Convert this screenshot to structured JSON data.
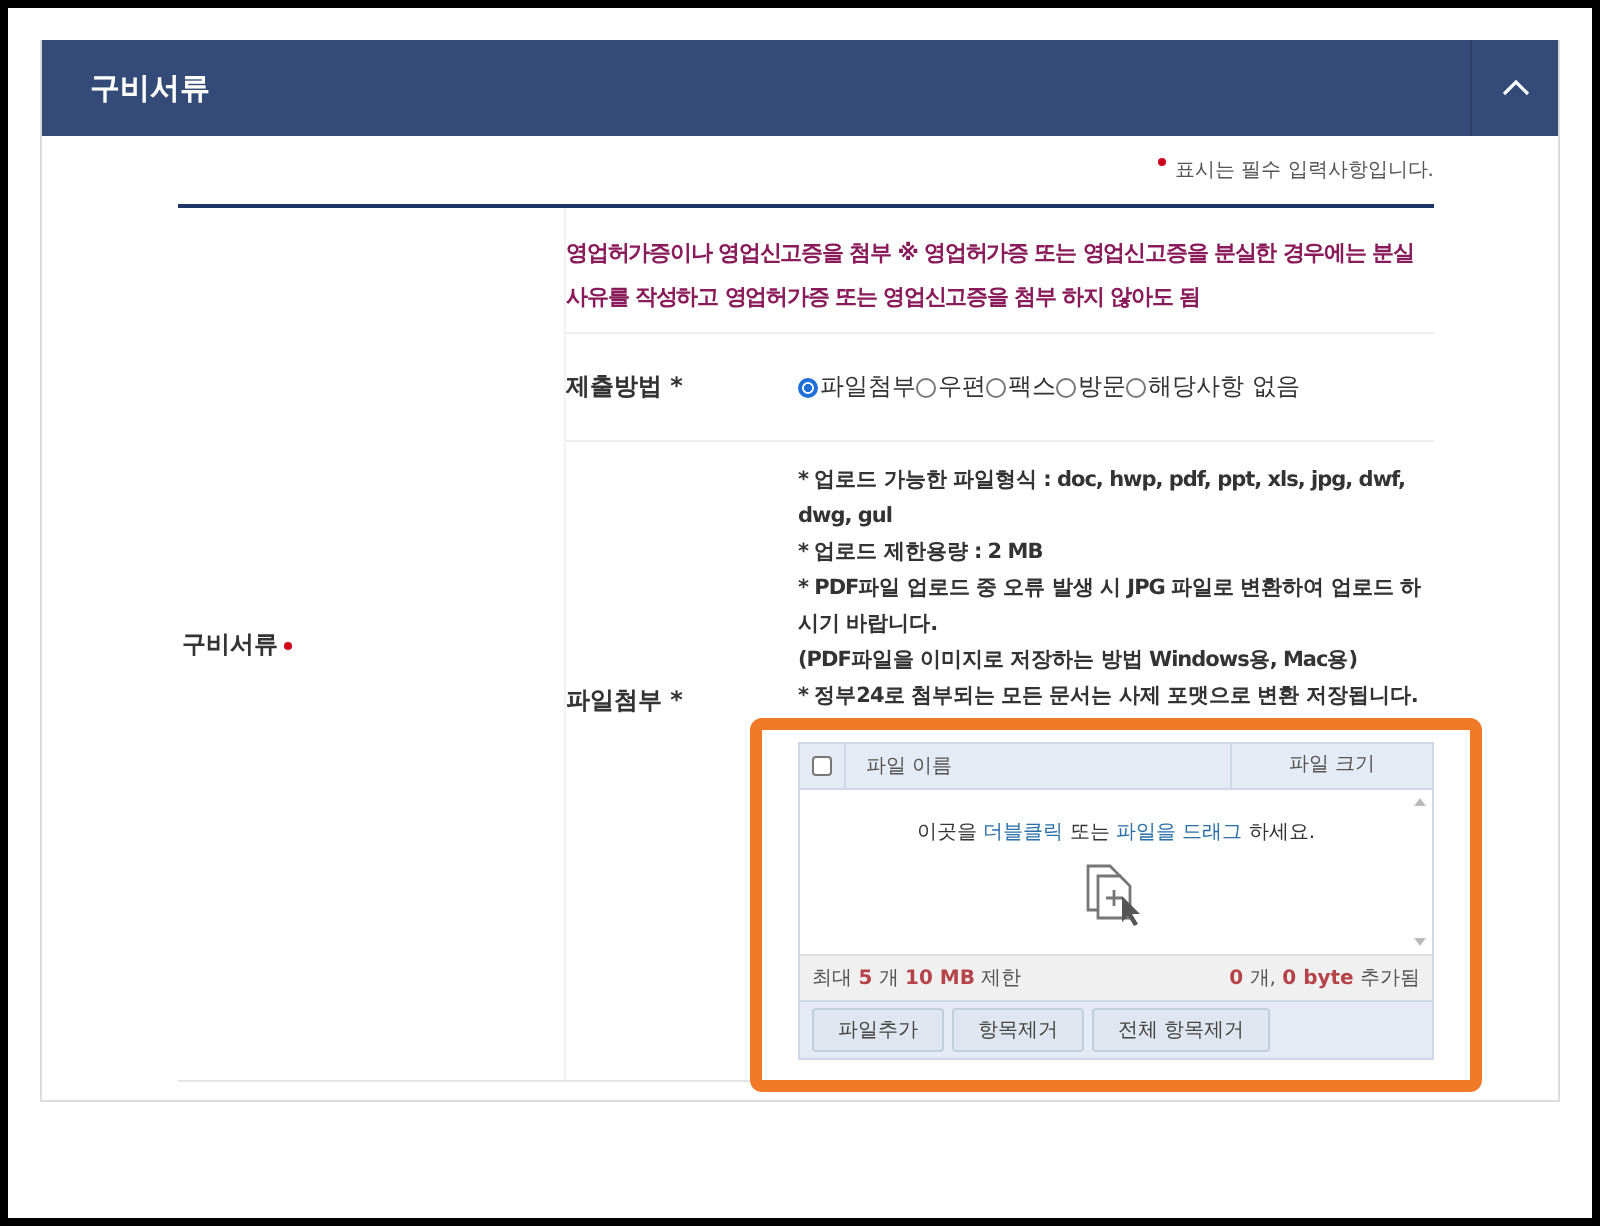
{
  "panel": {
    "title": "구비서류",
    "expanded": true
  },
  "required_note": "표시는 필수 입력사항입니다.",
  "section": {
    "label": "구비서류",
    "required": true
  },
  "notice": "영업허가증이나 영업신고증을 첨부 ※ 영업허가증 또는 영업신고증을 분실한 경우에는 분실 사유를 작성하고 영업허가증 또는 영업신고증을 첨부 하지 않아도 됨",
  "submit_method": {
    "label": "제출방법 *",
    "options": [
      {
        "label": "파일첨부",
        "selected": true
      },
      {
        "label": "우편",
        "selected": false
      },
      {
        "label": "팩스",
        "selected": false
      },
      {
        "label": "방문",
        "selected": false
      },
      {
        "label": "해당사항 없음",
        "selected": false
      }
    ]
  },
  "attachment": {
    "label": "파일첨부 *",
    "notes": [
      "* 업로드 가능한 파일형식 : doc, hwp, pdf, ppt, xls, jpg, dwf, dwg, gul",
      "* 업로드 제한용량 : 2 MB",
      "* PDF파일 업로드 중 오류 발생 시 JPG 파일로 변환하여 업로드 하시기 바랍니다.",
      " (PDF파일을 이미지로 저장하는 방법 Windows용, Mac용)",
      "* 정부24로 첨부되는 모든 문서는 사제 포맷으로 변환 저장됩니다."
    ],
    "uploader": {
      "select_all": false,
      "columns": [
        "파일 이름",
        "파일 크기"
      ],
      "hint": [
        {
          "text": "이곳을 ",
          "emphasis": false
        },
        {
          "text": "더블클릭",
          "emphasis": true
        },
        {
          "text": " 또는 ",
          "emphasis": false
        },
        {
          "text": "파일을 드래그",
          "emphasis": true
        },
        {
          "text": " 하세요.",
          "emphasis": false
        }
      ],
      "limit": "최대 **5** 개 **10 MB** 제한",
      "added": "**0** 개, **0 byte** 추가됨",
      "buttons": [
        "파일추가",
        "항목제거",
        "전체 항목제거"
      ]
    }
  }
}
